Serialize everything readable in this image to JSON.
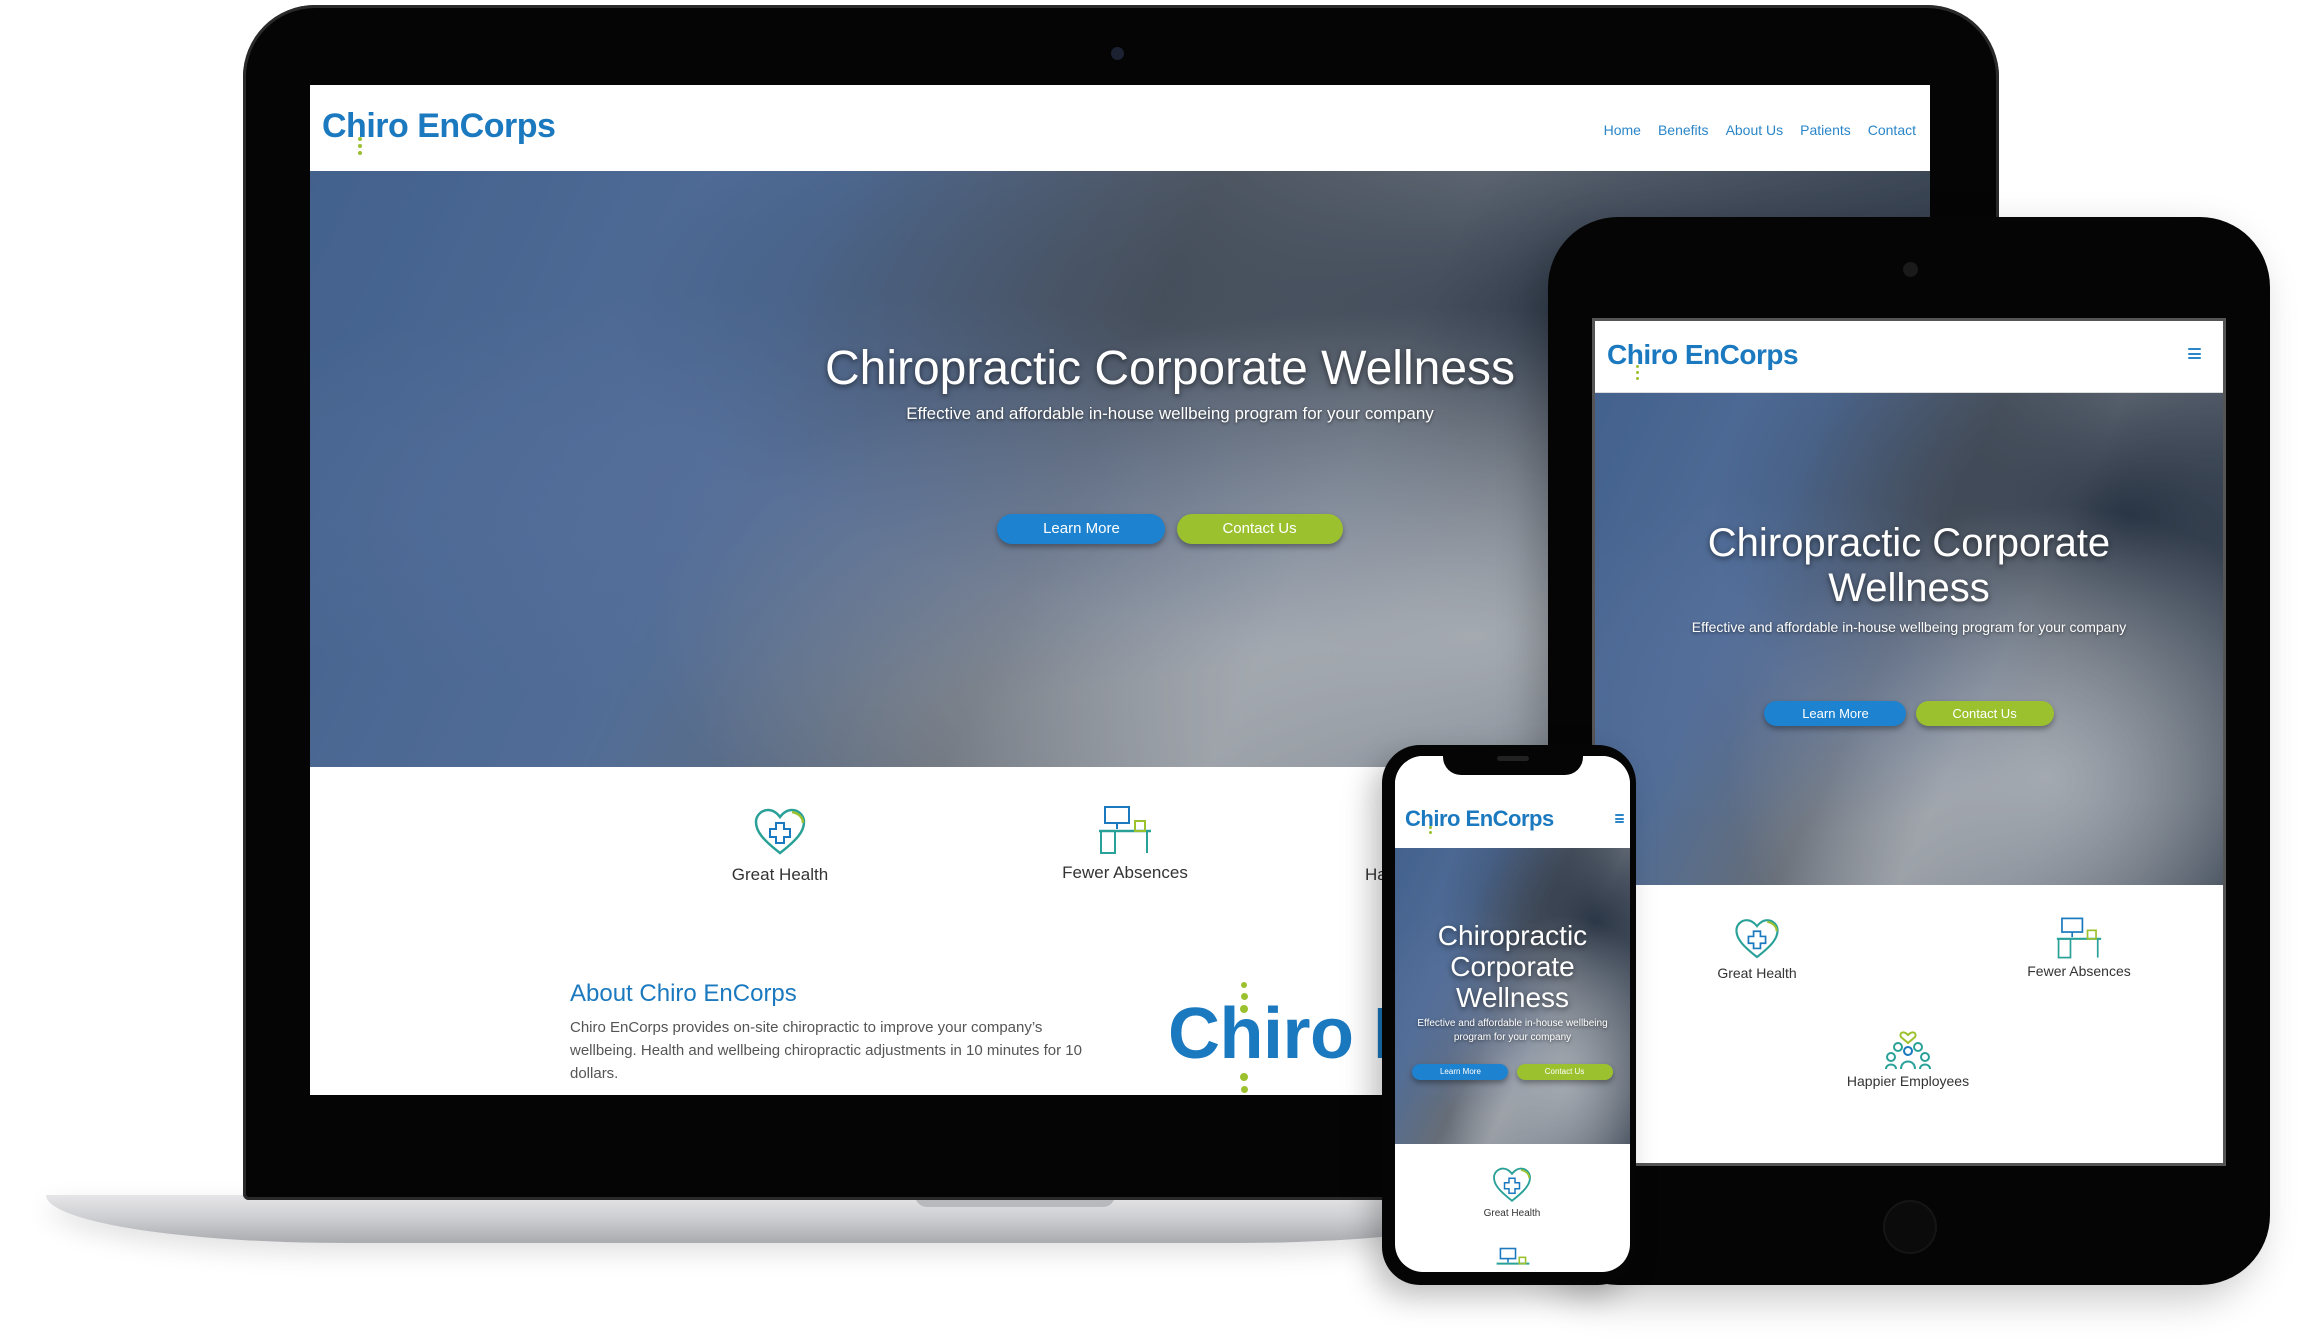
{
  "brand": {
    "name": "Chiro EnCorps",
    "colors": {
      "blue": "#1b79bf",
      "green": "#9cc12f",
      "nav": "#2a86c9"
    }
  },
  "laptop": {
    "nav": [
      "Home",
      "Benefits",
      "About Us",
      "Patients",
      "Contact"
    ],
    "hero": {
      "title": "Chiropractic Corporate Wellness",
      "subtitle": "Effective and affordable in-house wellbeing program for your company",
      "learn_more": "Learn More",
      "contact_us": "Contact Us"
    },
    "features": [
      {
        "label": "Great Health",
        "icon": "heart-plus-icon"
      },
      {
        "label": "Fewer Absences",
        "icon": "desk-computer-icon"
      },
      {
        "label": "Ha",
        "icon": "people-icon"
      }
    ],
    "about": {
      "title": "About Chiro EnCorps",
      "text": "Chiro EnCorps provides on-site chiropractic to improve your company’s wellbeing. Health and wellbeing chiropractic adjustments in 10 minutes for 10 dollars.",
      "logo_text": "Chiro En"
    }
  },
  "tablet": {
    "hero": {
      "title": "Chiropractic Corporate Wellness",
      "subtitle": "Effective and affordable in-house wellbeing program for your company",
      "learn_more": "Learn More",
      "contact_us": "Contact Us"
    },
    "features": [
      {
        "label": "Great Health",
        "icon": "heart-plus-icon"
      },
      {
        "label": "Fewer Absences",
        "icon": "desk-computer-icon"
      },
      {
        "label": "Happier Employees",
        "icon": "people-icon"
      }
    ]
  },
  "phone": {
    "hero": {
      "title": "Chiropractic Corporate Wellness",
      "subtitle": "Effective and affordable in-house wellbeing program for your company",
      "learn_more": "Learn More",
      "contact_us": "Contact Us"
    },
    "features": [
      {
        "label": "Great Health",
        "icon": "heart-plus-icon"
      }
    ]
  }
}
